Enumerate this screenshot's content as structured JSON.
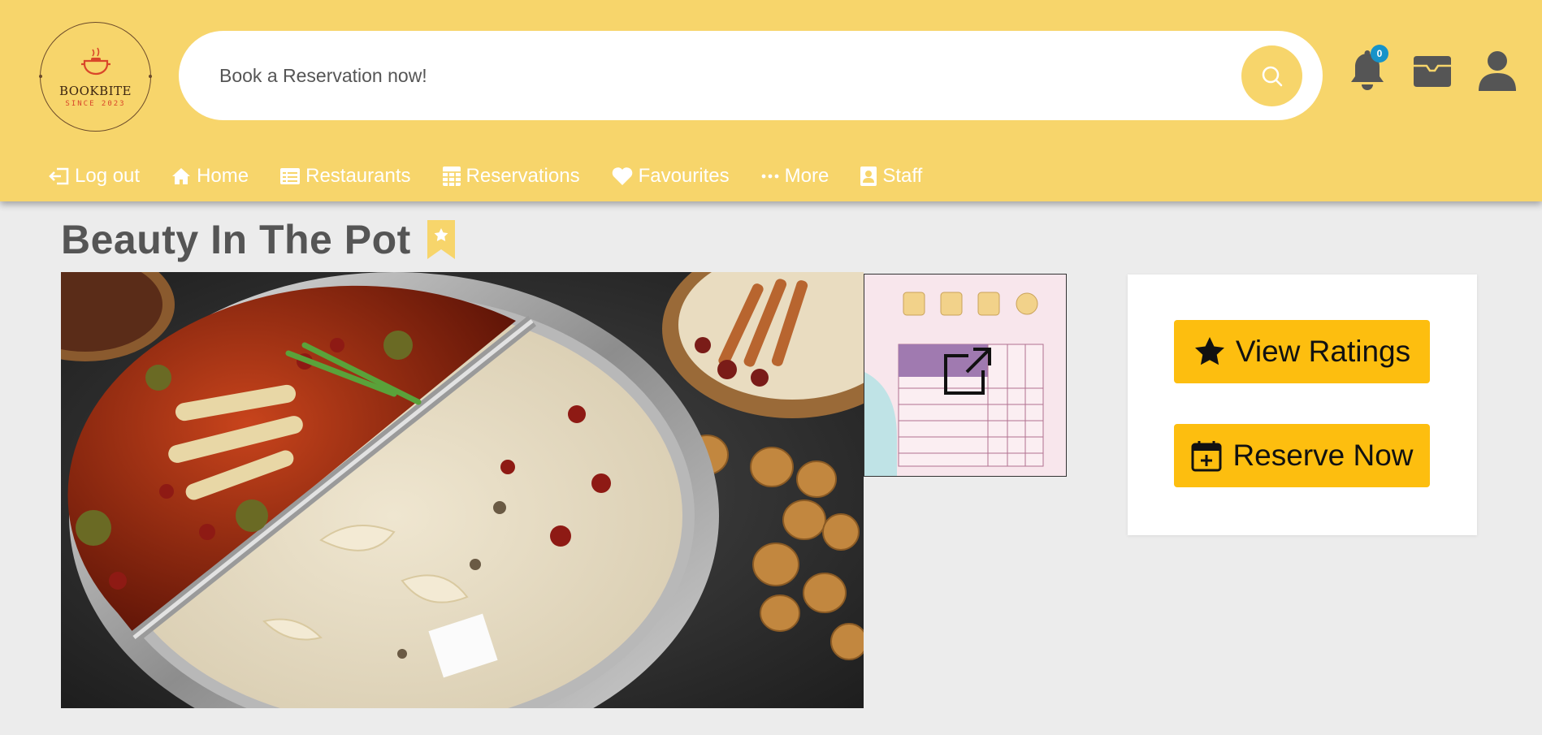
{
  "header": {
    "logo": {
      "name": "BOOKBITE",
      "tagline": "SINCE 2023"
    },
    "search": {
      "placeholder": "Book a Reservation now!"
    },
    "notifications": {
      "count": "0"
    }
  },
  "nav": {
    "items": [
      {
        "label": "Log out",
        "icon": "logout-icon"
      },
      {
        "label": "Home",
        "icon": "home-icon"
      },
      {
        "label": "Restaurants",
        "icon": "list-icon"
      },
      {
        "label": "Reservations",
        "icon": "calendar-table-icon"
      },
      {
        "label": "Favourites",
        "icon": "heart-icon"
      },
      {
        "label": "More",
        "icon": "ellipsis-icon"
      },
      {
        "label": "Staff",
        "icon": "id-badge-icon"
      }
    ]
  },
  "restaurant": {
    "name": "Beauty In The Pot"
  },
  "actions": {
    "view_ratings": "View Ratings",
    "reserve_now": "Reserve Now"
  },
  "colors": {
    "header_bg": "#f7d56b",
    "button_bg": "#fdbe0f",
    "badge_bg": "#1693c9",
    "page_bg": "#ececec"
  }
}
